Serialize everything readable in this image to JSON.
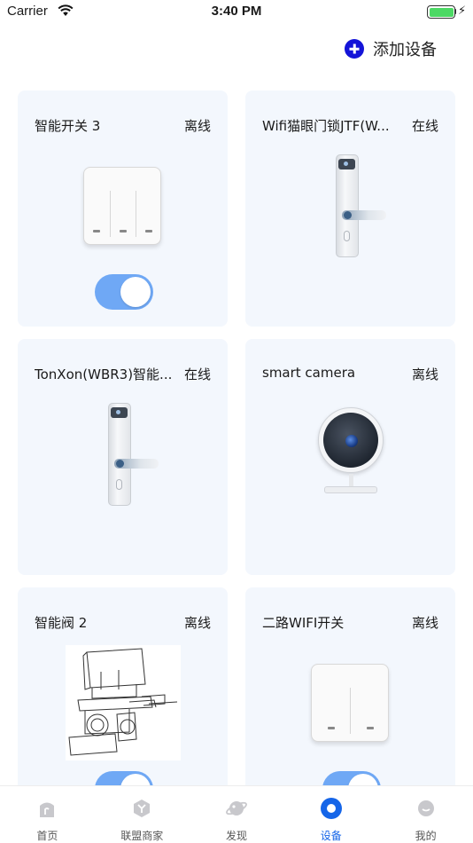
{
  "status_bar": {
    "carrier": "Carrier",
    "time": "3:40 PM",
    "battery_level": 1.0,
    "charging_symbol": "⚡"
  },
  "header": {
    "add_device_label": "添加设备",
    "add_icon": "plus-circle-icon"
  },
  "devices": [
    {
      "name": "智能开关 3",
      "status": "离线",
      "image": "three-gang-switch",
      "has_toggle": true,
      "toggle_on": true
    },
    {
      "name": "Wifi猫眼门锁JTF(W...",
      "status": "在线",
      "image": "smart-door-lock",
      "has_toggle": false
    },
    {
      "name": "TonXon(WBR3)智能...",
      "status": "在线",
      "image": "smart-door-lock",
      "has_toggle": false
    },
    {
      "name": "smart camera",
      "status": "离线",
      "image": "smart-camera",
      "has_toggle": false
    },
    {
      "name": "智能阀 2",
      "status": "离线",
      "image": "valve-sketch",
      "has_toggle": true,
      "toggle_on": true
    },
    {
      "name": "二路WIFI开关",
      "status": "离线",
      "image": "two-gang-switch",
      "has_toggle": true,
      "toggle_on": true
    }
  ],
  "tabs": [
    {
      "label": "首页",
      "icon": "home-icon",
      "active": false
    },
    {
      "label": "联盟商家",
      "icon": "merchant-icon",
      "active": false
    },
    {
      "label": "发现",
      "icon": "planet-icon",
      "active": false
    },
    {
      "label": "设备",
      "icon": "device-icon",
      "active": true
    },
    {
      "label": "我的",
      "icon": "profile-icon",
      "active": false
    }
  ],
  "colors": {
    "accent": "#1565e8",
    "add_icon": "#1414d8",
    "toggle_on": "#6fa8f5",
    "card_bg": "#f3f7fd"
  }
}
